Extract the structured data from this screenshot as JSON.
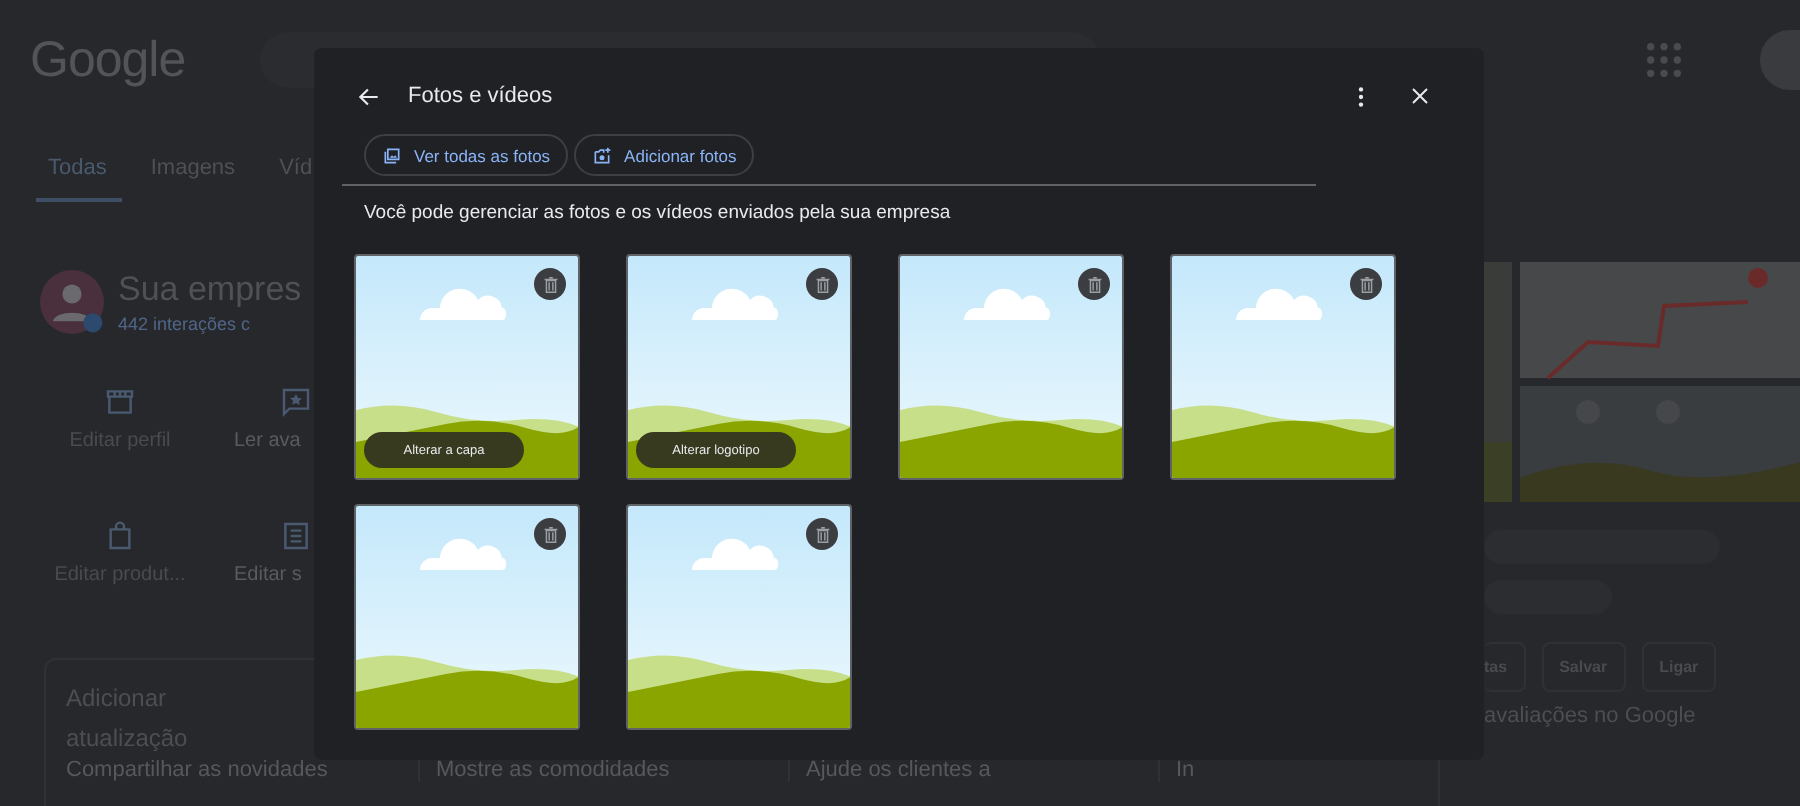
{
  "background_page": {
    "logo": "Google",
    "tabs": [
      {
        "label": "Todas",
        "selected": true
      },
      {
        "label": "Imagens",
        "selected": false
      },
      {
        "label": "Víd",
        "selected": false
      }
    ],
    "business": {
      "name": "Sua empres",
      "stats": "442 interações c"
    },
    "actions": [
      {
        "label": "Editar perfil",
        "kind": "store"
      },
      {
        "label": "Ler ava",
        "kind": "review"
      },
      {
        "label": "Editar produt...",
        "kind": "bag"
      },
      {
        "label": "Editar s",
        "kind": "list"
      }
    ],
    "update_card": {
      "title": "Adicionar atualização",
      "columns": [
        "Compartilhar as novidades",
        "Mostre as comodidades",
        "Ajude os clientes a",
        "In"
      ]
    },
    "side_buttons": [
      "tas",
      "Salvar",
      "Ligar"
    ],
    "reviews_heading": "avaliações no Google"
  },
  "dialog": {
    "title": "Fotos e vídeos",
    "chips": [
      {
        "label": "Ver todas as fotos",
        "kind": "gallery"
      },
      {
        "label": "Adicionar fotos",
        "kind": "add-photo"
      }
    ],
    "description": "Você pode gerenciar as fotos e os vídeos enviados pela sua empresa",
    "photos": [
      {
        "kind": "picture",
        "action": "Alterar a capa"
      },
      {
        "kind": "picture",
        "action": "Alterar logotipo"
      },
      {
        "kind": "picture"
      },
      {
        "kind": "picture"
      },
      {
        "kind": "picture"
      },
      {
        "kind": "picture"
      }
    ]
  }
}
